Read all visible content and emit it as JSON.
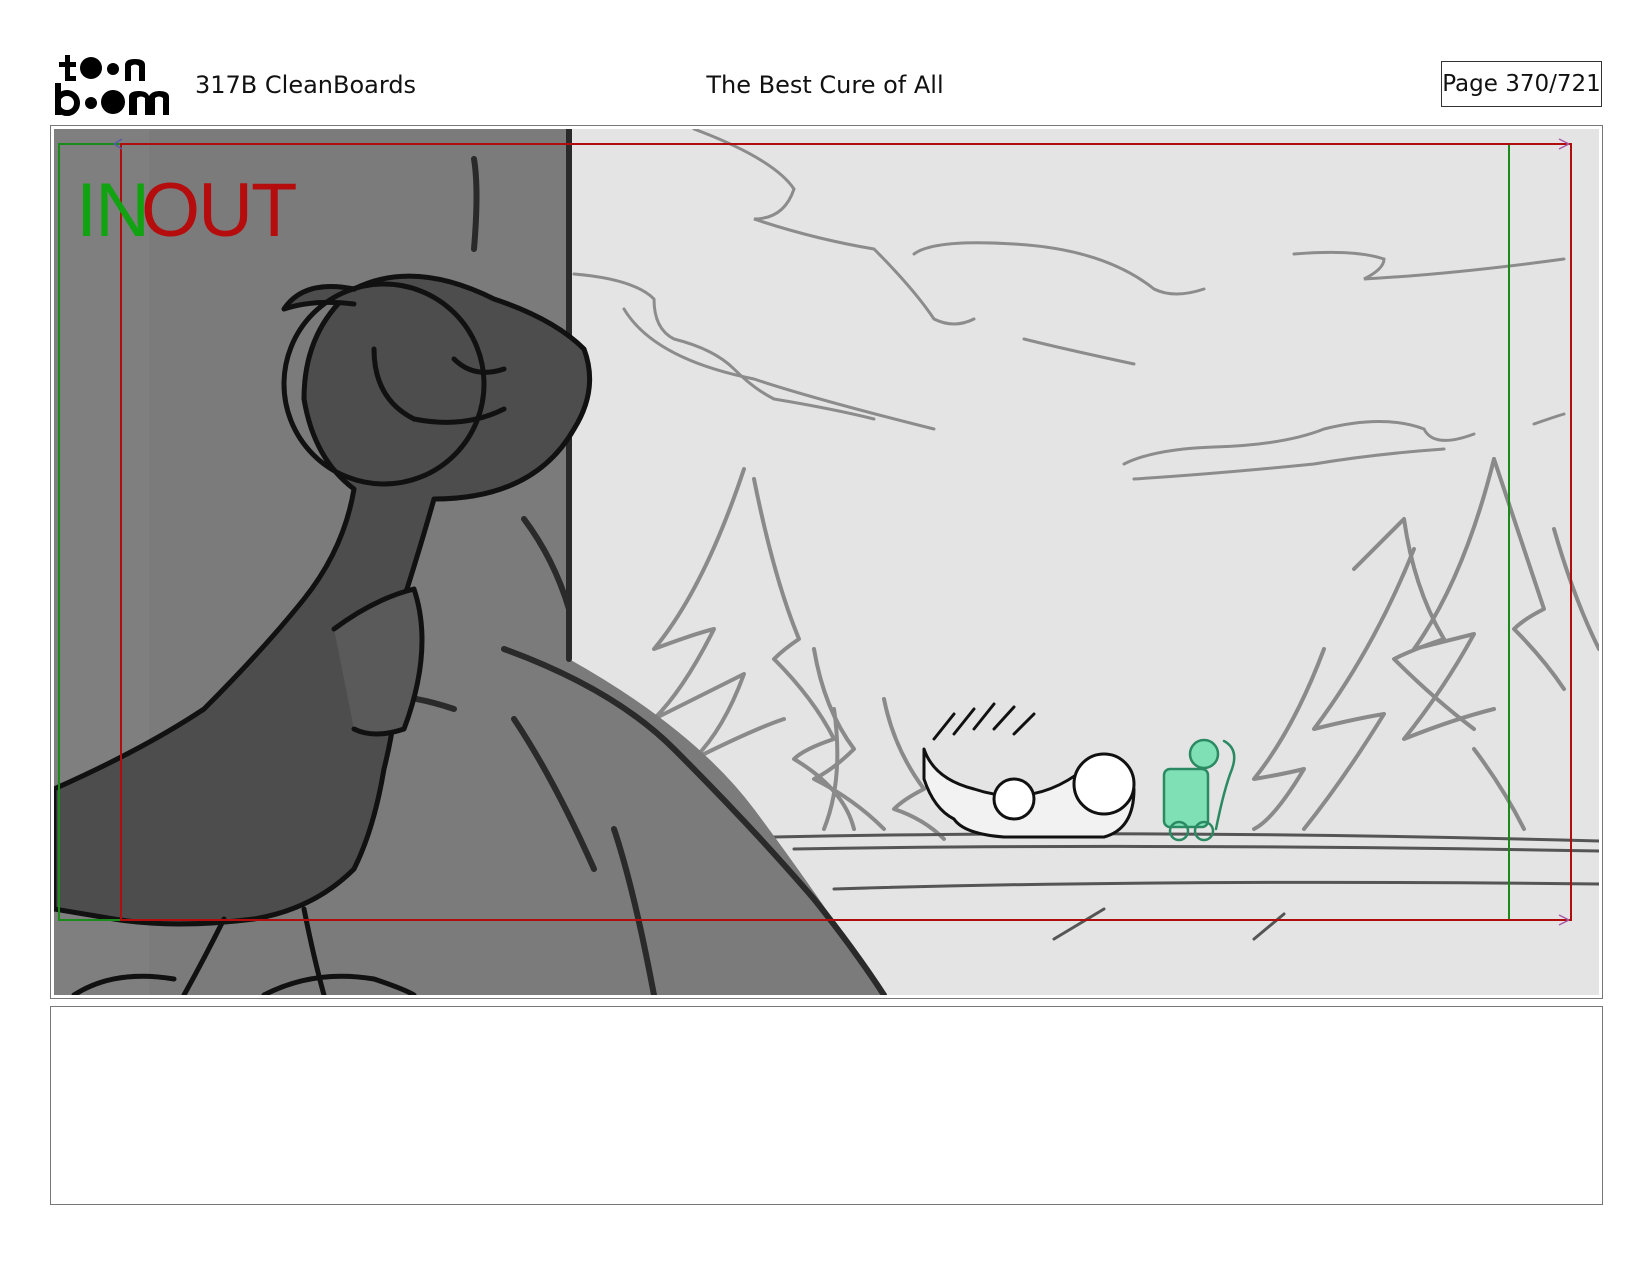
{
  "header": {
    "logo_text": "toon boom",
    "episode": "317B  CleanBoards",
    "title": "The Best Cure of All",
    "page": "Page 370/721"
  },
  "panel": {
    "in_label": "IN",
    "out_label": "OUT",
    "in_color": "#12a312",
    "out_color": "#b50d0d"
  },
  "notes": {
    "text": ""
  }
}
